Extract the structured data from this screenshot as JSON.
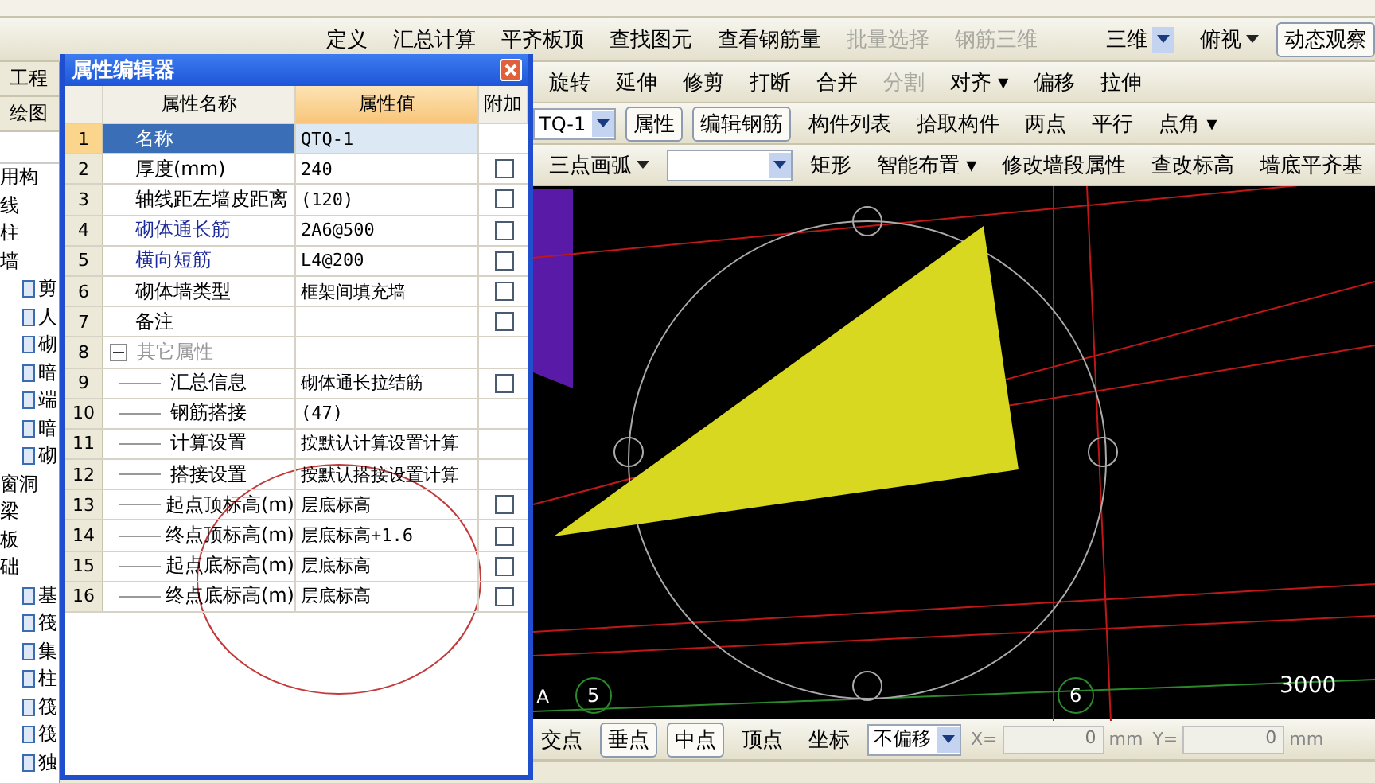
{
  "toolbar_main": [
    {
      "label": "定义",
      "disabled": false
    },
    {
      "label": "汇总计算",
      "disabled": false
    },
    {
      "label": "平齐板顶",
      "disabled": false
    },
    {
      "label": "查找图元",
      "disabled": false
    },
    {
      "label": "查看钢筋量",
      "disabled": false
    },
    {
      "label": "批量选择",
      "disabled": true
    },
    {
      "label": "钢筋三维",
      "disabled": true
    }
  ],
  "view_controls": {
    "mode": "三维",
    "view": "俯视",
    "orbit": "动态观察"
  },
  "left_tabs": [
    "工程",
    "绘图"
  ],
  "tree": [
    {
      "label": "用构"
    },
    {
      "label": "线"
    },
    {
      "label": "柱"
    },
    {
      "label": "墙",
      "children": [
        {
          "label": "剪"
        },
        {
          "label": "人"
        },
        {
          "label": "砌"
        },
        {
          "label": "暗"
        },
        {
          "label": "端"
        },
        {
          "label": "暗"
        },
        {
          "label": "砌"
        }
      ]
    },
    {
      "label": "窗洞"
    },
    {
      "label": "梁"
    },
    {
      "label": "板"
    },
    {
      "label": "础",
      "children": [
        {
          "label": "基"
        },
        {
          "label": "筏"
        },
        {
          "label": "集"
        },
        {
          "label": "柱"
        },
        {
          "label": "筏"
        },
        {
          "label": "筏"
        },
        {
          "label": "独"
        }
      ]
    }
  ],
  "toolbar_edit": [
    {
      "label": "旋转",
      "disabled": false
    },
    {
      "label": "延伸",
      "disabled": false
    },
    {
      "label": "修剪",
      "disabled": false
    },
    {
      "label": "打断",
      "disabled": false
    },
    {
      "label": "合并",
      "disabled": false
    },
    {
      "label": "分割",
      "disabled": true
    },
    {
      "label": "对齐 ▾",
      "disabled": false
    },
    {
      "label": "偏移",
      "disabled": false
    },
    {
      "label": "拉伸",
      "disabled": false
    }
  ],
  "component_select": "TQ-1",
  "toolbar_component": [
    {
      "label": "属性",
      "selected": true
    },
    {
      "label": "编辑钢筋",
      "selected": true
    },
    {
      "label": "构件列表",
      "selected": false
    },
    {
      "label": "拾取构件",
      "selected": false
    },
    {
      "label": "两点",
      "selected": false
    },
    {
      "label": "平行",
      "selected": false
    },
    {
      "label": "点角 ▾",
      "selected": false
    }
  ],
  "draw_mode": "三点画弧",
  "toolbar_draw": [
    "矩形",
    "智能布置 ▾",
    "修改墙段属性",
    "查改标高",
    "墙底平齐基"
  ],
  "dialog": {
    "title": "属性编辑器",
    "columns": [
      "属性名称",
      "属性值",
      "附加"
    ],
    "rows": [
      {
        "num": "1",
        "name": "名称",
        "value": "QTQ-1",
        "selected": true
      },
      {
        "num": "2",
        "name": "厚度(mm)",
        "value": "240",
        "selected": false,
        "checked": false
      },
      {
        "num": "3",
        "name": "轴线距左墙皮距离",
        "value": "(120)",
        "selected": false,
        "checked": false
      },
      {
        "num": "4",
        "name": "砌体通长筋",
        "value": "2A6@500",
        "selected": false,
        "checked": false,
        "color": "#1c2a9c"
      },
      {
        "num": "5",
        "name": "横向短筋",
        "value": "L4@200",
        "selected": false,
        "checked": false,
        "color": "#1c2a9c"
      },
      {
        "num": "6",
        "name": "砌体墙类型",
        "value": "框架间填充墙",
        "selected": false,
        "checked": false
      },
      {
        "num": "7",
        "name": "备注",
        "value": "",
        "selected": false,
        "checked": false
      },
      {
        "num": "8",
        "name": "其它属性",
        "selected": false,
        "expanded": true,
        "children": [
          {
            "num": "9",
            "name": "汇总信息",
            "value": "砌体通长拉结筋",
            "selected": false,
            "checked": false
          },
          {
            "num": "10",
            "name": "钢筋搭接",
            "value": "(47)",
            "selected": false
          },
          {
            "num": "11",
            "name": "计算设置",
            "value": "按默认计算设置计算",
            "selected": false
          },
          {
            "num": "12",
            "name": "搭接设置",
            "value": "按默认搭接设置计算",
            "selected": false
          },
          {
            "num": "13",
            "name": "起点顶标高(m)",
            "value": "层底标高",
            "selected": false,
            "checked": false
          },
          {
            "num": "14",
            "name": "终点顶标高(m)",
            "value": "层底标高+1.6",
            "selected": false,
            "checked": false
          },
          {
            "num": "15",
            "name": "起点底标高(m)",
            "value": "层底标高",
            "selected": false,
            "checked": false
          },
          {
            "num": "16",
            "name": "终点底标高(m)",
            "value": "层底标高",
            "selected": false,
            "checked": false
          }
        ]
      }
    ]
  },
  "canvas": {
    "axis_labels": [
      "A",
      "5",
      "6"
    ],
    "dimension": "3000"
  },
  "snap_bar": [
    {
      "label": "交点",
      "selected": false
    },
    {
      "label": "垂点",
      "selected": true
    },
    {
      "label": "中点",
      "selected": true
    },
    {
      "label": "顶点",
      "selected": false
    },
    {
      "label": "坐标",
      "selected": false
    }
  ],
  "offset_select": "不偏移",
  "coords": [
    {
      "label": "X=",
      "value": "0",
      "unit": "mm",
      "disabled": true
    },
    {
      "label": "Y=",
      "value": "0",
      "unit": "mm",
      "disabled": true
    }
  ]
}
